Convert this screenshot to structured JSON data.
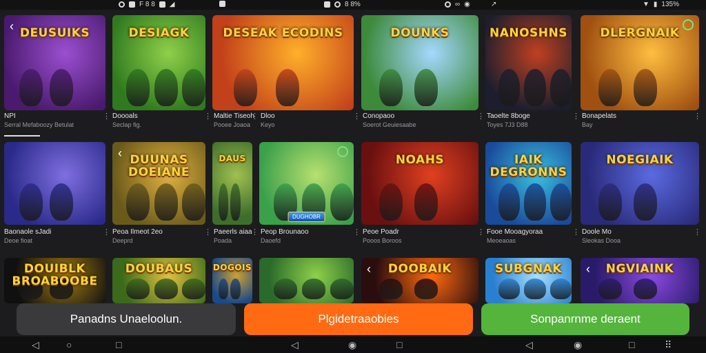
{
  "status_bar": {
    "left_time": "",
    "center_left": "F 8 8",
    "center_a": "8 8%",
    "right_pct": "135%"
  },
  "tiles_row1": [
    {
      "title": "DEUSUIKS",
      "sub": "",
      "meta_title": "NPI",
      "meta_sub": "Serral Mefaboozy Betulat",
      "colors": [
        "#4a1a6e",
        "#9b4fd0"
      ]
    },
    {
      "title": "DESIAGK",
      "sub": "",
      "meta_title": "Doooals",
      "meta_sub": "Seclap fig.",
      "colors": [
        "#2f7a1e",
        "#8fd04a"
      ]
    },
    {
      "title": "DESEAK ECODINS",
      "sub": "",
      "meta_title": "Maltie Tiseoh",
      "meta_sub": "Pooee Joaoa",
      "colors": [
        "#c2401a",
        "#ffb02a"
      ]
    },
    {
      "title": "",
      "sub": "",
      "meta_title": "Dloo",
      "meta_sub": "Keyo",
      "colors": [
        "#2a3ea0",
        "#ffb040"
      ]
    },
    {
      "title": "DOUNKS",
      "sub": "",
      "meta_title": "Conopaoo",
      "meta_sub": "Soerot Geuiesaabe",
      "colors": [
        "#3c8a3a",
        "#a6d8ff"
      ]
    },
    {
      "title": "NANOSHNS",
      "sub": "",
      "meta_title": "Taoelte 8boge",
      "meta_sub": "Toyes 7J3 D88",
      "colors": [
        "#1c1e2e",
        "#c04020"
      ]
    },
    {
      "title": "DLERGNAIK",
      "sub": "",
      "meta_title": "Bonapelats",
      "meta_sub": "Bay",
      "colors": [
        "#a05010",
        "#ffbe40"
      ]
    }
  ],
  "tiles_row2": [
    {
      "title": "",
      "sub": "",
      "meta_title": "Baonaole sJadi",
      "meta_sub": "Deoe fioat",
      "colors": [
        "#2a2a8a",
        "#7f6fe0"
      ]
    },
    {
      "title": "DUUNAS DOEIANE",
      "sub": "",
      "meta_title": "Peoa Ilmeot 2eo",
      "meta_sub": "Deeprd",
      "colors": [
        "#6a5a1a",
        "#e0b040"
      ]
    },
    {
      "title": "DAUS",
      "sub": "",
      "meta_title": "Paeerls aiaa",
      "meta_sub": "Poada",
      "colors": [
        "#3e6e2a",
        "#a0c050"
      ]
    },
    {
      "title": "",
      "sub": "DUGHOBR",
      "meta_title": "Peop Brounaoo",
      "meta_sub": "Daoefd",
      "colors": [
        "#3aa04a",
        "#b8e070"
      ]
    },
    {
      "title": "NOAHS",
      "sub": "",
      "meta_title": "Peoe Poadr",
      "meta_sub": "Pooos Boroos",
      "colors": [
        "#6a1010",
        "#e04020"
      ]
    },
    {
      "title": "IAIK DEGRONNS",
      "sub": "",
      "meta_title": "Fooe Mooagyoraa",
      "meta_sub": "Meoeaoas",
      "colors": [
        "#1a4a9a",
        "#3ac0e0"
      ]
    },
    {
      "title": "NOEGIAIK",
      "sub": "",
      "meta_title": "Doole Mo",
      "meta_sub": "Sleokas Dooa",
      "colors": [
        "#2a2a7a",
        "#5a6ae0"
      ]
    }
  ],
  "tiles_row3": [
    {
      "title": "DOUIBLK BROABOOBE",
      "colors": [
        "#101010",
        "#a07a10"
      ]
    },
    {
      "title": "DOUBAUS",
      "colors": [
        "#3a6a1a",
        "#e0c040"
      ]
    },
    {
      "title": "DOGOIS",
      "colors": [
        "#1a4a8a",
        "#d0a030"
      ]
    },
    {
      "title": "",
      "colors": [
        "#2a6a2a",
        "#8fd04a"
      ]
    },
    {
      "title": "DOOBAIK",
      "colors": [
        "#2a0e0e",
        "#ff6a10"
      ]
    },
    {
      "title": "SUBGNAK",
      "colors": [
        "#2a80d0",
        "#a6e0ff"
      ]
    },
    {
      "title": "NGVIAINK",
      "colors": [
        "#2a1a6a",
        "#8a4ae0"
      ]
    }
  ],
  "buttons": {
    "left": "Panadns Unaeloolun.",
    "center": "Plgidetraaobies",
    "right": "Sonpanrnme deraent"
  }
}
